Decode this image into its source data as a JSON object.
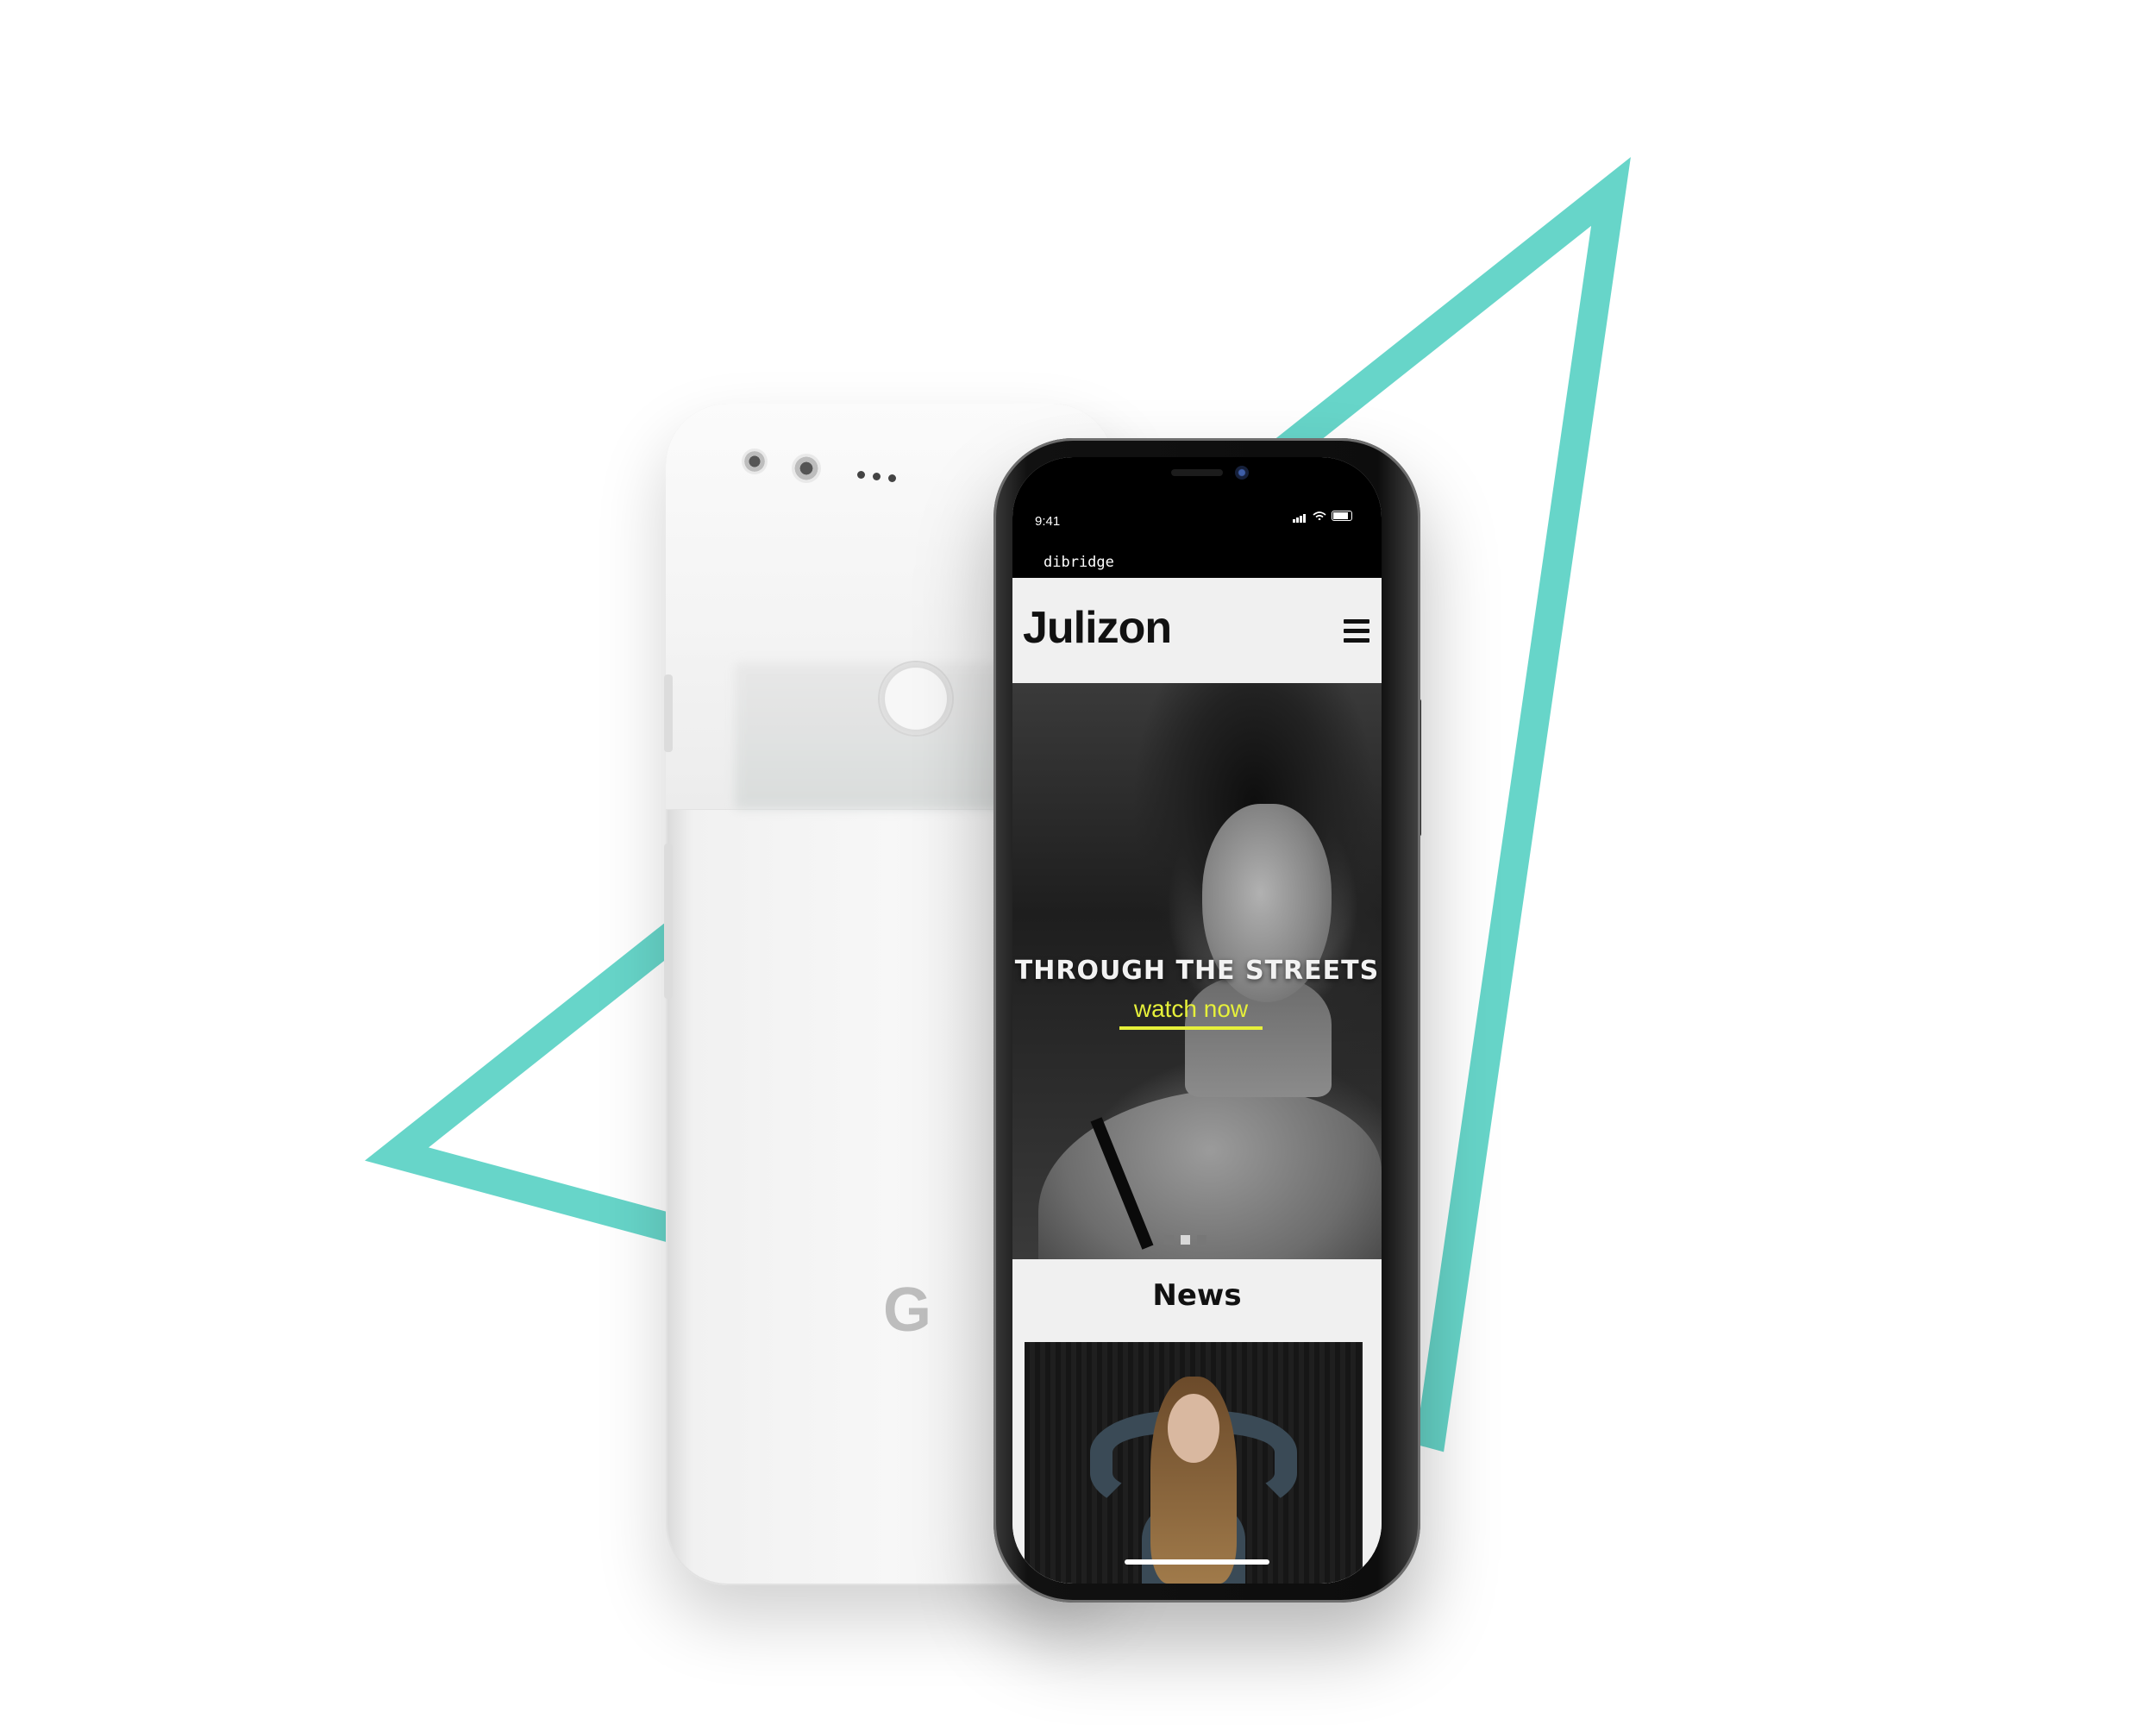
{
  "colors": {
    "accent_teal": "#67d5c9",
    "cta_yellow": "#e6f03a",
    "page_bg": "#ffffff"
  },
  "back_device": {
    "logo": "G"
  },
  "front_device": {
    "status_bar": {
      "time": "9:41"
    },
    "browser": {
      "url": "dibridge"
    },
    "site": {
      "brand": "Julizon",
      "menu_icon": "hamburger-menu-icon",
      "hero": {
        "title": "THROUGH THE STREETS",
        "cta": "watch now",
        "slides": 3,
        "active_slide": 2
      },
      "news": {
        "title": "News"
      }
    }
  }
}
